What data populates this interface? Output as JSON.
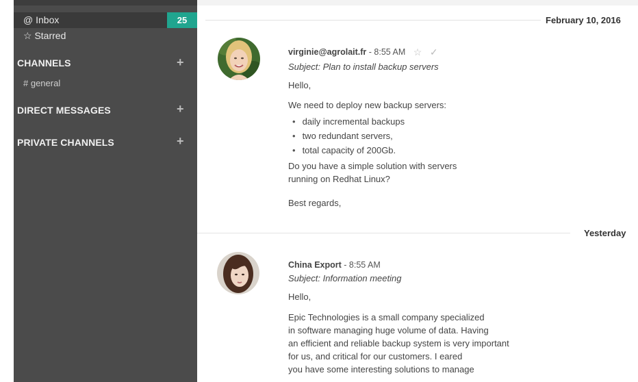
{
  "sidebar": {
    "inbox_label": "@ Inbox",
    "inbox_count": "25",
    "starred_label": "☆ Starred",
    "sections": [
      {
        "title": "CHANNELS",
        "add": "+"
      },
      {
        "title": "DIRECT MESSAGES",
        "add": "+"
      },
      {
        "title": "PRIVATE CHANNELS",
        "add": "+"
      }
    ],
    "channel_general": "# general"
  },
  "thread": {
    "dates": [
      "February 10, 2016",
      "Yesterday"
    ],
    "messages": [
      {
        "from": "virginie@agrolait.fr",
        "time": "- 8:55 AM",
        "star_icon": "star-outline-icon",
        "check_icon": "check-icon",
        "subject": "Subject: Plan to install backup servers",
        "greeting": "Hello,",
        "intro": "We need to deploy new backup servers:",
        "bullets": [
          "daily incremental backups",
          "two redundant servers,",
          "total capacity of 200Gb."
        ],
        "question_1": "Do you have a simple solution with servers",
        "question_2": "running on Redhat Linux?",
        "sign": "Best regards,"
      },
      {
        "from": "China Export",
        "time": "- 8:55 AM",
        "subject": "Subject: Information meeting",
        "greeting": "Hello,",
        "lines": [
          "Epic Technologies is a small company specialized",
          "in software managing huge volume of data. Having",
          "an efficient and reliable backup system is very important",
          "for us, and critical for our customers. I eared",
          "you have some interesting solutions to manage"
        ]
      }
    ]
  },
  "colors": {
    "sidebar_bg": "#4b4b4b",
    "badge_bg": "#20a58f"
  }
}
